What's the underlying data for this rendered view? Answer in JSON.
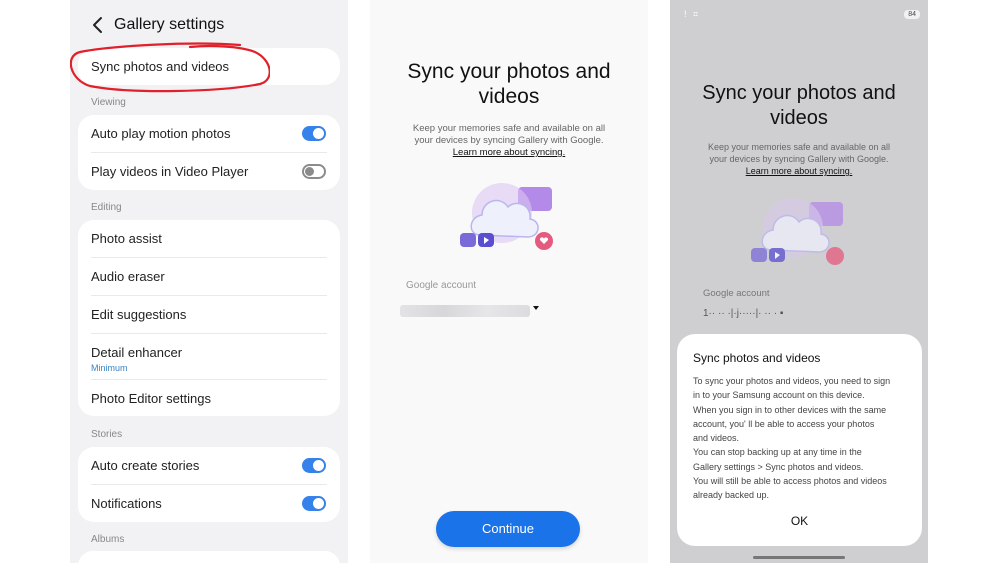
{
  "settings": {
    "title": "Gallery settings",
    "sync_item": "Sync photos and videos",
    "sections": {
      "viewing": "Viewing",
      "editing": "Editing",
      "stories": "Stories",
      "albums": "Albums"
    },
    "viewing_items": [
      {
        "label": "Auto play motion photos",
        "toggle": "on"
      },
      {
        "label": "Play videos in Video Player",
        "toggle": "off"
      }
    ],
    "editing_items": [
      {
        "label": "Photo assist"
      },
      {
        "label": "Audio eraser"
      },
      {
        "label": "Edit suggestions"
      },
      {
        "label": "Detail enhancer",
        "sub": "Minimum"
      },
      {
        "label": "Photo Editor settings"
      }
    ],
    "stories_items": [
      {
        "label": "Auto create stories",
        "toggle": "on"
      },
      {
        "label": "Notifications",
        "toggle": "on"
      }
    ],
    "annotation_color": "#e0202a",
    "accent": "#3582ea"
  },
  "sync_screen": {
    "title_line1": "Sync your photos and",
    "title_line2": "videos",
    "desc_line1": "Keep your memories safe and available on all",
    "desc_line2": "your devices by syncing Gallery with Google.",
    "learn_more": "Learn more about syncing.",
    "google_account_label": "Google account",
    "continue_label": "Continue",
    "button_color": "#1a73e8"
  },
  "dialog_screen": {
    "battery": "84",
    "status_icons": "!  ⌗",
    "account_text": "1·· ·· ·|·j·····|· ·· · ▪",
    "dialog_title": "Sync photos and videos",
    "body": [
      "To sync your photos and videos, you need to sign",
      "in to your Samsung account on this device.",
      "When you sign in to other devices with the same",
      "account, you' ll be able to access your photos",
      "and videos.",
      "You can stop backing up at any time in the",
      "Gallery settings > Sync photos and videos.",
      "You will still be able to access photos and videos",
      "already backed up."
    ],
    "ok_label": "OK"
  }
}
